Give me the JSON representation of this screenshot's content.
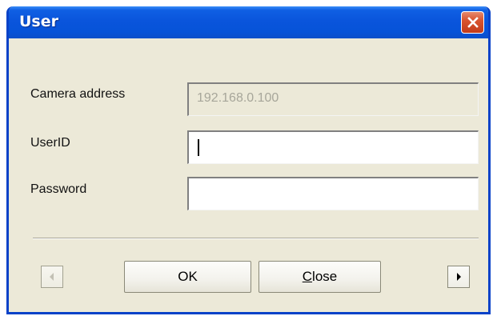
{
  "window": {
    "title": "User",
    "close_icon": "close-icon"
  },
  "form": {
    "camera_address_label": "Camera address",
    "camera_address_value": "192.168.0.100",
    "userid_label": "UserID",
    "userid_value": "",
    "password_label": "Password",
    "password_value": ""
  },
  "buttons": {
    "ok_label": "OK",
    "close_label": "Close",
    "close_mnemonic": "C",
    "close_rest": "lose",
    "scroll_left_icon": "triangle-left-icon",
    "scroll_right_icon": "triangle-right-icon"
  },
  "colors": {
    "titlebar": "#0a55dc",
    "dialog_bg": "#ece9d8",
    "close_button": "#d9542f"
  }
}
